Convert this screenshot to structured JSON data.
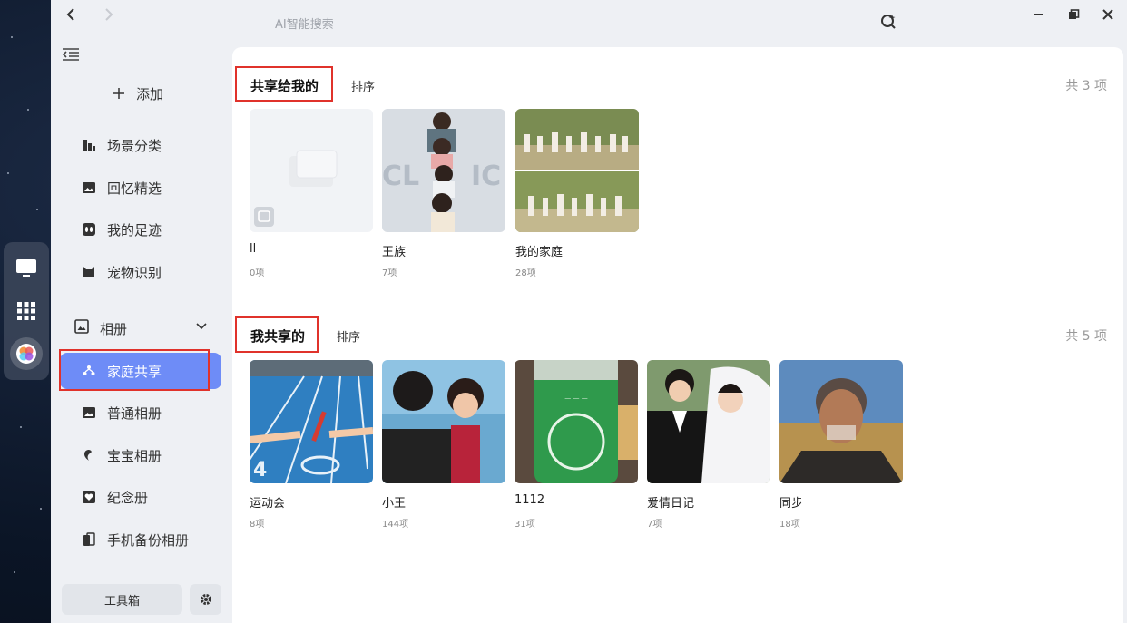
{
  "titlebar": {
    "search_placeholder": "AI智能搜索",
    "back_icon": "chevron-left-icon",
    "forward_icon": "chevron-right-icon",
    "search_icon": "ai-search-icon",
    "minimize_icon": "minimize-icon",
    "restore_icon": "restore-icon",
    "close_icon": "close-icon"
  },
  "sidebar": {
    "add_label": "添加",
    "items": [
      {
        "label": "场景分类",
        "icon": "scene-icon"
      },
      {
        "label": "回忆精选",
        "icon": "image-icon"
      },
      {
        "label": "我的足迹",
        "icon": "footprint-icon"
      },
      {
        "label": "宠物识别",
        "icon": "pet-icon"
      }
    ],
    "album_header": {
      "label": "相册",
      "icon": "album-icon"
    },
    "albums": [
      {
        "label": "家庭共享",
        "icon": "family-share-icon",
        "active": true
      },
      {
        "label": "普通相册",
        "icon": "album-icon",
        "active": false
      },
      {
        "label": "宝宝相册",
        "icon": "baby-icon",
        "active": false
      },
      {
        "label": "纪念册",
        "icon": "heart-icon",
        "active": false
      },
      {
        "label": "手机备份相册",
        "icon": "phone-backup-icon",
        "active": false
      }
    ],
    "toolbox_label": "工具箱"
  },
  "shared_to_me": {
    "title": "共享给我的",
    "sort_label": "排序",
    "count_label": "共 3 项",
    "albums": [
      {
        "name": "ll",
        "count": "0项"
      },
      {
        "name": "王族",
        "count": "7项"
      },
      {
        "name": "我的家庭",
        "count": "28项"
      }
    ]
  },
  "my_shared": {
    "title": "我共享的",
    "sort_label": "排序",
    "count_label": "共 5 项",
    "albums": [
      {
        "name": "运动会",
        "count": "8项"
      },
      {
        "name": "小王",
        "count": "144项"
      },
      {
        "name": "1112",
        "count": "31项"
      },
      {
        "name": "爱情日记",
        "count": "7项"
      },
      {
        "name": "同步",
        "count": "18项"
      }
    ]
  },
  "colors": {
    "accent": "#6e8cf7",
    "highlight_box": "#e0322b"
  }
}
